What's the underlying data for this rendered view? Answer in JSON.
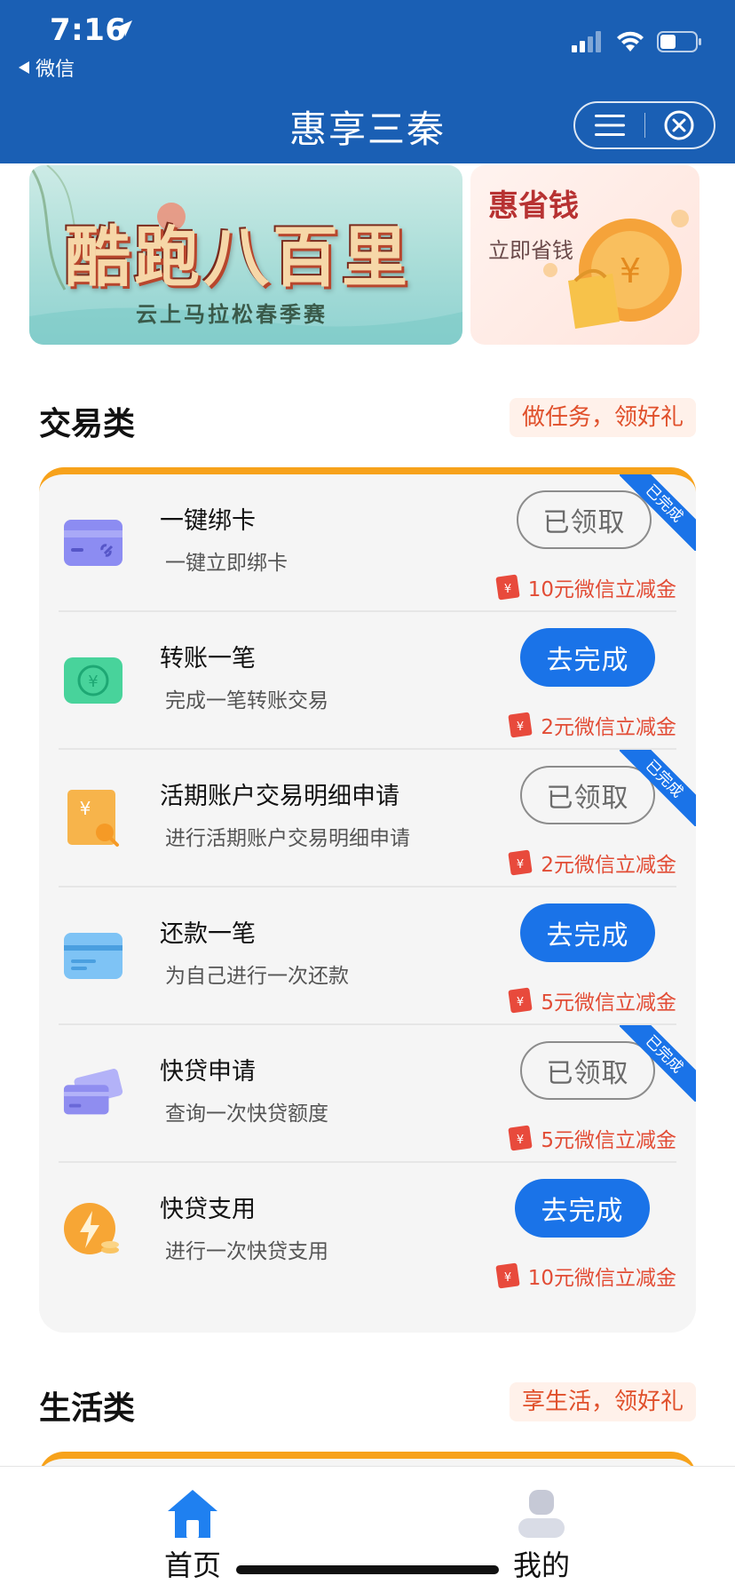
{
  "status_bar": {
    "time": "7:16",
    "back_app": "微信"
  },
  "header": {
    "title": "惠享三秦"
  },
  "banners": {
    "main": {
      "title": "酷跑八百里",
      "subtitle": "云上马拉松春季赛"
    },
    "side": {
      "title": "惠省钱",
      "subtitle": "立即省钱"
    }
  },
  "sections": {
    "trade": {
      "title": "交易类",
      "tag": "做任务，领好礼"
    },
    "life": {
      "title": "生活类",
      "tag": "享生活，领好礼"
    }
  },
  "tasks": [
    {
      "title": "一键绑卡",
      "desc": "一键立即绑卡",
      "button": "已领取",
      "state": "done",
      "reward": "10元微信立减金",
      "ribbon": "已完成",
      "icon": "card-link-icon",
      "color": "#8c8cf2"
    },
    {
      "title": "转账一笔",
      "desc": "完成一笔转账交易",
      "button": "去完成",
      "state": "todo",
      "reward": "2元微信立减金",
      "ribbon": "",
      "icon": "transfer-icon",
      "color": "#48d39b"
    },
    {
      "title": "活期账户交易明细申请",
      "desc": "进行活期账户交易明细申请",
      "button": "已领取",
      "state": "done",
      "reward": "2元微信立减金",
      "ribbon": "已完成",
      "icon": "statement-search-icon",
      "color": "#f7b44b"
    },
    {
      "title": "还款一笔",
      "desc": "为自己进行一次还款",
      "button": "去完成",
      "state": "todo",
      "reward": "5元微信立减金",
      "ribbon": "",
      "icon": "repay-card-icon",
      "color": "#7ec3f5"
    },
    {
      "title": "快贷申请",
      "desc": "查询一次快贷额度",
      "button": "已领取",
      "state": "done",
      "reward": "5元微信立减金",
      "ribbon": "已完成",
      "icon": "loan-cards-icon",
      "color": "#8f8df0"
    },
    {
      "title": "快贷支用",
      "desc": "进行一次快贷支用",
      "button": "去完成",
      "state": "todo",
      "reward": "10元微信立减金",
      "ribbon": "",
      "icon": "lightning-coin-icon",
      "color": "#f7a635"
    }
  ],
  "tabbar": {
    "home": "首页",
    "mine": "我的"
  },
  "colors": {
    "header_bg": "#1a5fb4",
    "accent_blue": "#1a73e8",
    "accent_orange": "#f7a21b",
    "reward_red": "#e24c35"
  }
}
